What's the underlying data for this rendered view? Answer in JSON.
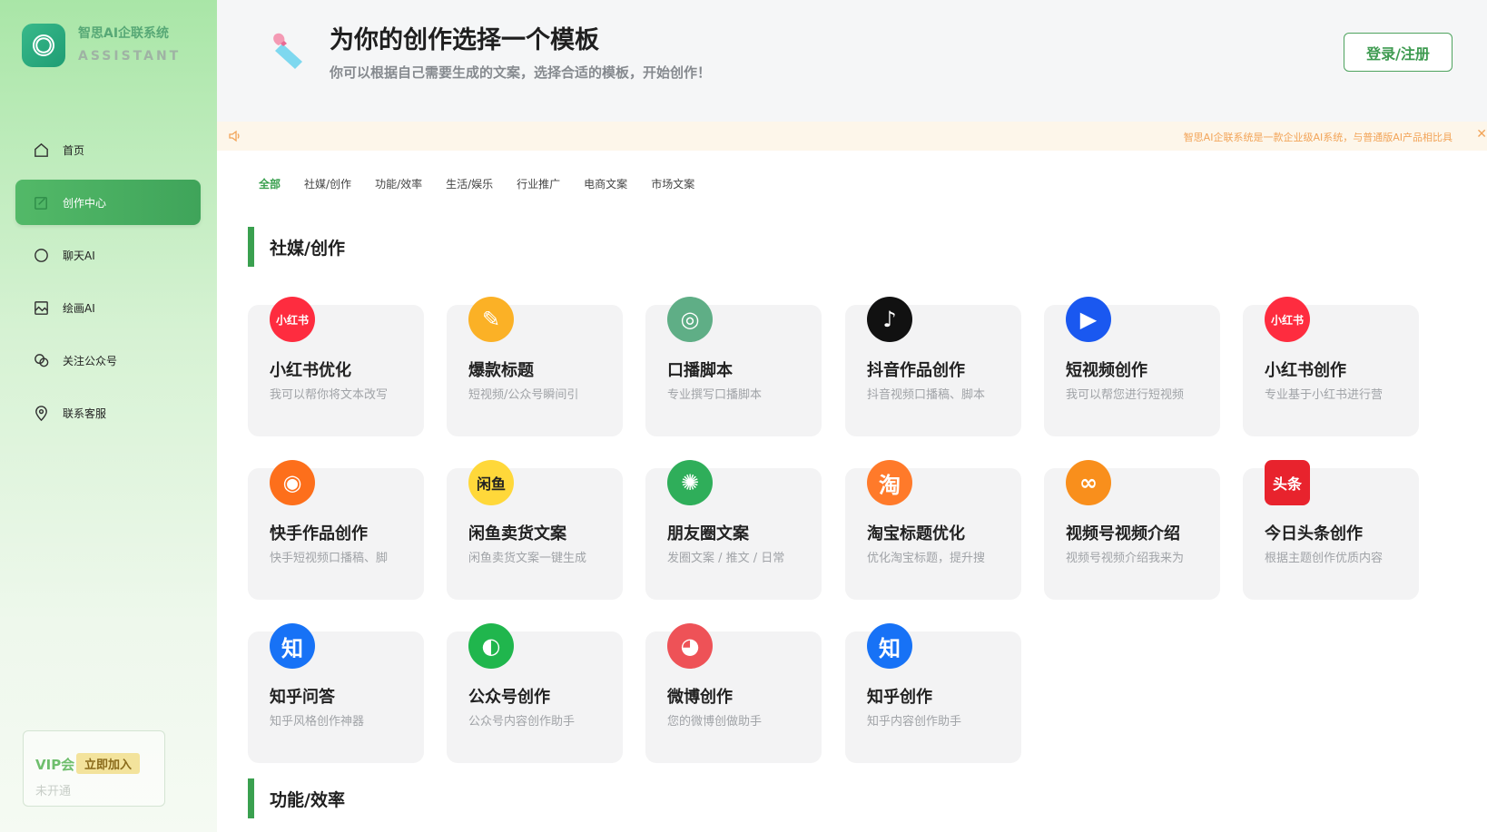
{
  "brand": {
    "title": "智思AI企联系统",
    "subtitle": "ASSISTANT"
  },
  "nav": [
    {
      "label": "首页",
      "icon": "home-icon"
    },
    {
      "label": "创作中心",
      "icon": "edit-icon",
      "active": true
    },
    {
      "label": "聊天AI",
      "icon": "chat-icon"
    },
    {
      "label": "绘画AI",
      "icon": "image-icon"
    },
    {
      "label": "关注公众号",
      "icon": "wechat-icon"
    },
    {
      "label": "联系客服",
      "icon": "location-icon"
    }
  ],
  "vip": {
    "title": "VIP会",
    "join": "立即加入",
    "status": "未开通"
  },
  "header": {
    "title": "为你的创作选择一个模板",
    "subtitle": "你可以根据自己需要生成的文案，选择合适的模板，开始创作！",
    "login": "登录/注册"
  },
  "notice": {
    "text": "智思AI企联系统是一款企业级AI系统，与普通版AI产品相比具",
    "close": "✕"
  },
  "tabs": [
    "全部",
    "社媒/创作",
    "功能/效率",
    "生活/娱乐",
    "行业推广",
    "电商文案",
    "市场文案"
  ],
  "sections": [
    {
      "title": "社媒/创作"
    },
    {
      "title": "功能/效率"
    }
  ],
  "cards": [
    {
      "title": "小红书优化",
      "desc": "我可以帮你将文本改写",
      "icon_text": "小红书",
      "icon": "xiaohongshu-icon",
      "color": "#fe2c3f"
    },
    {
      "title": "爆款标题",
      "desc": "短视频/公众号瞬间引",
      "icon_text": "✎",
      "icon": "pen-icon",
      "color": "#fbb126"
    },
    {
      "title": "口播脚本",
      "desc": "专业撰写口播脚本",
      "icon_text": "◎",
      "icon": "script-icon",
      "color": "#5fae86"
    },
    {
      "title": "抖音作品创作",
      "desc": "抖音视频口播稿、脚本",
      "icon_text": "♪",
      "icon": "douyin-icon",
      "color": "#111111"
    },
    {
      "title": "短视频创作",
      "desc": "我可以帮您进行短视频",
      "icon_text": "▶",
      "icon": "play-icon",
      "color": "#1a58f0"
    },
    {
      "title": "小红书创作",
      "desc": "专业基于小红书进行营",
      "icon_text": "小红书",
      "icon": "xiaohongshu-icon",
      "color": "#fe2c3f"
    },
    {
      "title": "快手作品创作",
      "desc": "快手短视频口播稿、脚",
      "icon_text": "◉",
      "icon": "kuaishou-icon",
      "color": "#fd6f1b"
    },
    {
      "title": "闲鱼卖货文案",
      "desc": "闲鱼卖货文案一键生成",
      "icon_text": "闲鱼",
      "icon": "xianyu-icon",
      "color": "#ffd83a"
    },
    {
      "title": "朋友圈文案",
      "desc": "发圈文案 / 推文 / 日常",
      "icon_text": "✺",
      "icon": "moments-icon",
      "color": "#2fae5a"
    },
    {
      "title": "淘宝标题优化",
      "desc": "优化淘宝标题，提升搜",
      "icon_text": "淘",
      "icon": "taobao-icon",
      "color": "#ff7a2a"
    },
    {
      "title": "视频号视频介绍",
      "desc": "视频号视频介绍我来为",
      "icon_text": "∞",
      "icon": "channels-icon",
      "color": "#f98f1c"
    },
    {
      "title": "今日头条创作",
      "desc": "根据主题创作优质内容",
      "icon_text": "头条",
      "icon": "toutiao-icon",
      "color": "#e8232d"
    },
    {
      "title": "知乎问答",
      "desc": "知乎风格创作神器",
      "icon_text": "知",
      "icon": "zhihu-icon",
      "color": "#1772f6"
    },
    {
      "title": "公众号创作",
      "desc": "公众号内容创作助手",
      "icon_text": "◐",
      "icon": "wechat-official-icon",
      "color": "#20b64d"
    },
    {
      "title": "微博创作",
      "desc": "您的微博创做助手",
      "icon_text": "◕",
      "icon": "weibo-icon",
      "color": "#ee5257"
    },
    {
      "title": "知乎创作",
      "desc": "知乎内容创作助手",
      "icon_text": "知",
      "icon": "zhihu-icon",
      "color": "#1772f6"
    }
  ],
  "colors": {
    "accent": "#3aa04f",
    "notice": "#f2a458"
  }
}
